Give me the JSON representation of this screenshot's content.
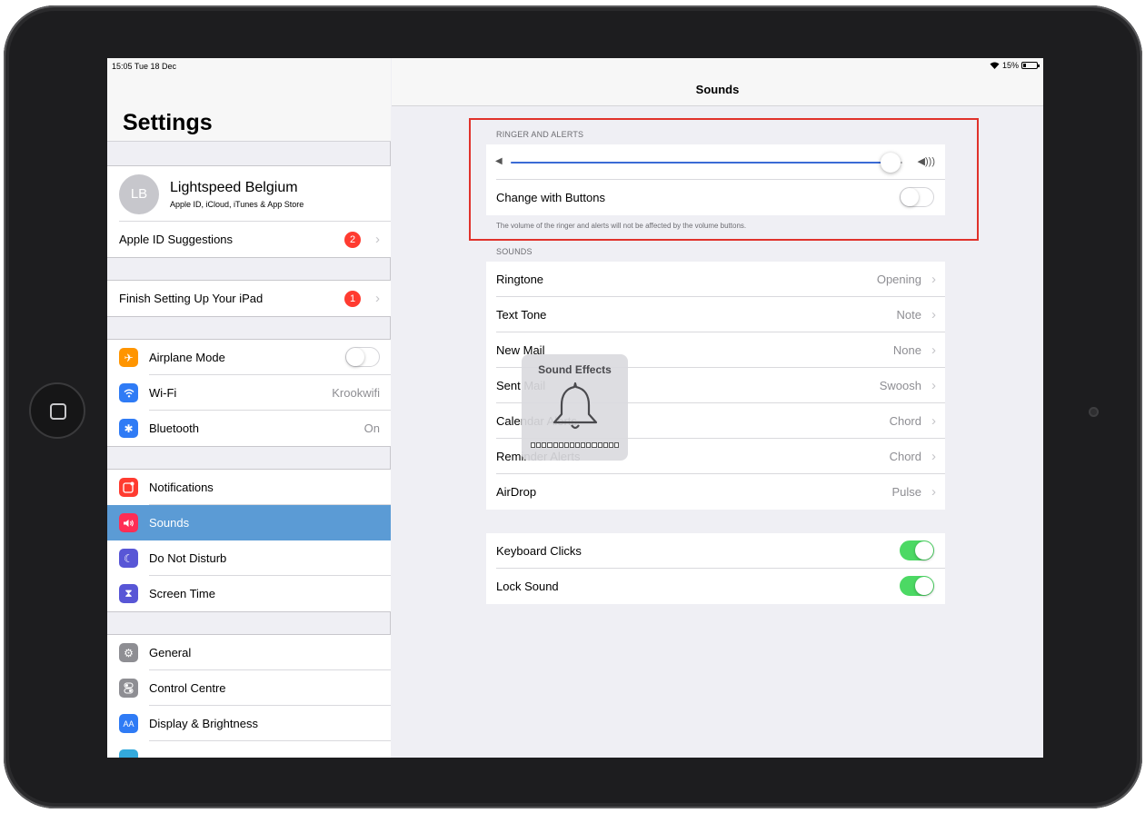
{
  "status_bar": {
    "time": "15:05  Tue 18 Dec",
    "battery": "15%"
  },
  "sidebar": {
    "title": "Settings",
    "profile": {
      "initials": "LB",
      "name": "Lightspeed Belgium",
      "subtitle": "Apple ID, iCloud, iTunes & App Store"
    },
    "apple_id_suggestions": {
      "label": "Apple ID Suggestions",
      "badge": "2"
    },
    "finish_setup": {
      "label": "Finish Setting Up Your iPad",
      "badge": "1"
    },
    "connectivity": [
      {
        "label": "Airplane Mode",
        "icon": "airplane-icon",
        "color": "#ff9500",
        "toggle": false
      },
      {
        "label": "Wi-Fi",
        "icon": "wifi-icon",
        "color": "#2f7bf5",
        "value": "Krookwifi"
      },
      {
        "label": "Bluetooth",
        "icon": "bluetooth-icon",
        "color": "#2f7bf5",
        "value": "On"
      }
    ],
    "alerts": [
      {
        "label": "Notifications",
        "icon": "notifications-icon",
        "color": "#ff3b30"
      },
      {
        "label": "Sounds",
        "icon": "speaker-icon",
        "color": "#ff2d55",
        "selected": true
      },
      {
        "label": "Do Not Disturb",
        "icon": "moon-icon",
        "color": "#5856d6"
      },
      {
        "label": "Screen Time",
        "icon": "hourglass-icon",
        "color": "#5856d6"
      }
    ],
    "system": [
      {
        "label": "General",
        "icon": "gear-icon",
        "color": "#8e8e93"
      },
      {
        "label": "Control Centre",
        "icon": "toggles-icon",
        "color": "#8e8e93"
      },
      {
        "label": "Display & Brightness",
        "icon": "text-size-icon",
        "color": "#2f7bf5"
      }
    ]
  },
  "detail": {
    "title": "Sounds",
    "ringer": {
      "header": "RINGER AND ALERTS",
      "volume_level": 0.97,
      "change_with_buttons": {
        "label": "Change with Buttons",
        "on": false
      },
      "footer": "The volume of the ringer and alerts will not be affected by the volume buttons."
    },
    "sounds": {
      "header": "SOUNDS",
      "rows": [
        {
          "label": "Ringtone",
          "value": "Opening"
        },
        {
          "label": "Text Tone",
          "value": "Note"
        },
        {
          "label": "New Mail",
          "value": "None"
        },
        {
          "label": "Sent Mail",
          "value": "Swoosh"
        },
        {
          "label": "Calendar Alerts",
          "value": "Chord"
        },
        {
          "label": "Reminder Alerts",
          "value": "Chord"
        },
        {
          "label": "AirDrop",
          "value": "Pulse"
        }
      ]
    },
    "clicks": [
      {
        "label": "Keyboard Clicks",
        "on": true
      },
      {
        "label": "Lock Sound",
        "on": true
      }
    ]
  },
  "hud": {
    "title": "Sound Effects",
    "icon": "bell-icon",
    "level": 1.0
  }
}
